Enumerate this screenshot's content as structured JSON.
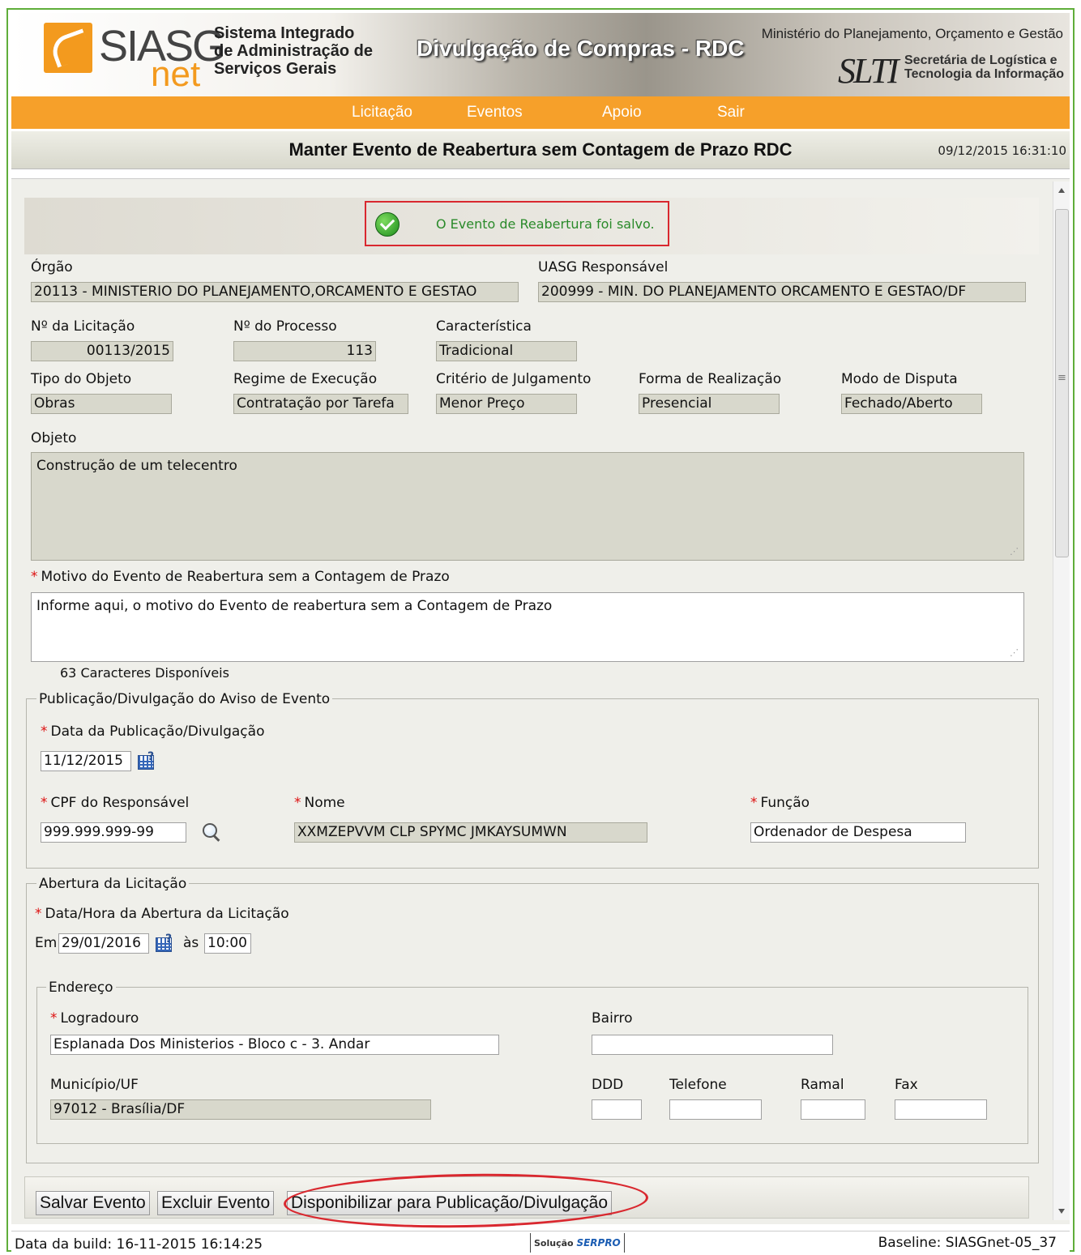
{
  "header": {
    "logo_siasg": "SIASG",
    "logo_net": "net",
    "system_name": "Sistema Integrado de Administração de Serviços Gerais",
    "app_title": "Divulgação de Compras - RDC",
    "ministry": "Ministério do Planejamento, Orçamento e Gestão",
    "slti": "SLTI",
    "slti_sub": "Secretária de Logística e Tecnologia da Informação"
  },
  "nav": {
    "items": [
      "Licitação",
      "Eventos",
      "Apoio",
      "Sair"
    ]
  },
  "page": {
    "title": "Manter Evento de Reabertura sem Contagem de Prazo RDC",
    "datetime": "09/12/2015 16:31:10"
  },
  "message": {
    "text": "O Evento de Reabertura foi salvo.",
    "icon": "check-circle-icon"
  },
  "form": {
    "orgao": {
      "label": "Órgão",
      "value": "20113 - MINISTERIO DO PLANEJAMENTO,ORCAMENTO E GESTAO"
    },
    "uasg": {
      "label": "UASG Responsável",
      "value": "200999 - MIN. DO PLANEJAMENTO ORCAMENTO E GESTAO/DF"
    },
    "licitacao": {
      "label": "Nº da Licitação",
      "value": "00113/2015"
    },
    "processo": {
      "label": "Nº do Processo",
      "value": "113"
    },
    "caracteristica": {
      "label": "Característica",
      "value": "Tradicional"
    },
    "tipo_objeto": {
      "label": "Tipo do Objeto",
      "value": "Obras"
    },
    "regime": {
      "label": "Regime de Execução",
      "value": "Contratação por Tarefa"
    },
    "criterio": {
      "label": "Critério de Julgamento",
      "value": "Menor Preço"
    },
    "forma": {
      "label": "Forma de Realização",
      "value": "Presencial"
    },
    "modo": {
      "label": "Modo de Disputa",
      "value": "Fechado/Aberto"
    },
    "objeto": {
      "label": "Objeto",
      "value": "Construção de um telecentro"
    },
    "motivo": {
      "label": "Motivo do Evento de Reabertura sem a Contagem de Prazo",
      "value": "Informe aqui, o motivo do Evento de reabertura sem a Contagem de Prazo",
      "counter": "63 Caracteres Disponíveis"
    }
  },
  "publicacao": {
    "legend": "Publicação/Divulgação do Aviso de Evento",
    "data_label": "Data da Publicação/Divulgação",
    "data_value": "11/12/2015",
    "cpf_label": "CPF do Responsável",
    "cpf_value": "999.999.999-99",
    "nome_label": "Nome",
    "nome_value": "XXMZEPVVM CLP SPYMC JMKAYSUMWN",
    "funcao_label": "Função",
    "funcao_value": "Ordenador de Despesa"
  },
  "abertura": {
    "legend": "Abertura da Licitação",
    "datahora_label": "Data/Hora da Abertura da Licitação",
    "em_label": "Em",
    "data_value": "29/01/2016",
    "as_label": "às",
    "hora_value": "10:00",
    "endereco": {
      "legend": "Endereço",
      "logradouro_label": "Logradouro",
      "logradouro_value": "Esplanada Dos Ministerios - Bloco c - 3. Andar",
      "bairro_label": "Bairro",
      "bairro_value": "",
      "municipio_label": "Município/UF",
      "municipio_value": "97012 - Brasília/DF",
      "ddd_label": "DDD",
      "telefone_label": "Telefone",
      "ramal_label": "Ramal",
      "fax_label": "Fax"
    }
  },
  "buttons": {
    "salvar": "Salvar Evento",
    "excluir": "Excluir Evento",
    "disponibilizar": "Disponibilizar para Publicação/Divulgação"
  },
  "footer": {
    "build": "Data da build: 16-11-2015 16:14:25",
    "solucao": "Solução",
    "serpro": "SERPRO",
    "baseline": "Baseline: SIASGnet-05_37"
  },
  "colors": {
    "nav_orange": "#f6a02a",
    "frame_green": "#5fae3a",
    "success_green": "#2a8a2a",
    "highlight_red": "#d9282f",
    "readonly_bg": "#d8d8cc"
  }
}
